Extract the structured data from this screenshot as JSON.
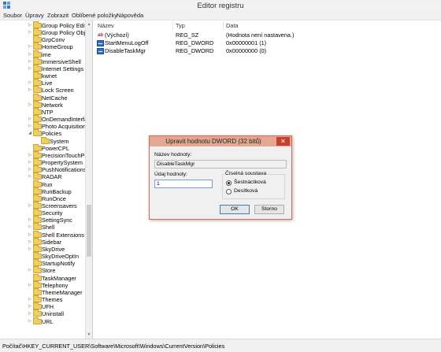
{
  "window": {
    "title": "Editor registru"
  },
  "menu": [
    "Soubor",
    "Úpravy",
    "Zobrazit",
    "Oblíbené položky",
    "Nápověda"
  ],
  "tree": {
    "items": [
      {
        "label": "Group Policy Editor",
        "expander": "▷"
      },
      {
        "label": "Group Policy Objec",
        "expander": "▷"
      },
      {
        "label": "GrpConv",
        "expander": ""
      },
      {
        "label": "HomeGroup",
        "expander": "▷"
      },
      {
        "label": "ime",
        "expander": "▷"
      },
      {
        "label": "ImmersiveShell",
        "expander": "▷"
      },
      {
        "label": "Internet Settings",
        "expander": "▷"
      },
      {
        "label": "kwnet",
        "expander": ""
      },
      {
        "label": "Live",
        "expander": "▷"
      },
      {
        "label": "Lock Screen",
        "expander": "▷"
      },
      {
        "label": "NetCache",
        "expander": ""
      },
      {
        "label": "Network",
        "expander": "▷"
      },
      {
        "label": "NTP",
        "expander": ""
      },
      {
        "label": "OnDemandInterfac",
        "expander": "▷"
      },
      {
        "label": "Photo Acquisition",
        "expander": "▷"
      },
      {
        "label": "Policies",
        "expander": "◢"
      },
      {
        "label": "System",
        "expander": "",
        "child": true
      },
      {
        "label": "PowerCPL",
        "expander": ""
      },
      {
        "label": "PrecisionTouchPad",
        "expander": "▷"
      },
      {
        "label": "PropertySystem",
        "expander": "▷"
      },
      {
        "label": "PushNotifications",
        "expander": "▷"
      },
      {
        "label": "RADAR",
        "expander": "▷"
      },
      {
        "label": "Run",
        "expander": ""
      },
      {
        "label": "RunBackup",
        "expander": ""
      },
      {
        "label": "RunOnce",
        "expander": ""
      },
      {
        "label": "Screensavers",
        "expander": "▷"
      },
      {
        "label": "Security",
        "expander": ""
      },
      {
        "label": "SettingSync",
        "expander": "▷"
      },
      {
        "label": "Shell",
        "expander": "▷"
      },
      {
        "label": "Shell Extensions",
        "expander": "▷"
      },
      {
        "label": "Sidebar",
        "expander": "▷"
      },
      {
        "label": "SkyDrive",
        "expander": "▷"
      },
      {
        "label": "SkyDriveOptIn",
        "expander": ""
      },
      {
        "label": "StartupNotify",
        "expander": ""
      },
      {
        "label": "Store",
        "expander": "▷"
      },
      {
        "label": "TaskManager",
        "expander": ""
      },
      {
        "label": "Telephony",
        "expander": "▷"
      },
      {
        "label": "ThemeManager",
        "expander": ""
      },
      {
        "label": "Themes",
        "expander": "▷"
      },
      {
        "label": "UFH",
        "expander": "▷"
      },
      {
        "label": "Uninstall",
        "expander": "▷"
      },
      {
        "label": "URL",
        "expander": "▷"
      }
    ]
  },
  "list": {
    "columns": [
      "Název",
      "Typ",
      "Data"
    ],
    "rows": [
      {
        "icon": "string-value-icon",
        "badge": "ab",
        "name": "(Výchozí)",
        "type": "REG_SZ",
        "data": "(Hodnota není nastavena.)"
      },
      {
        "icon": "dword-value-icon",
        "badge": "",
        "name": "StartMenuLogOff",
        "type": "REG_DWORD",
        "data": "0x00000001 (1)"
      },
      {
        "icon": "dword-value-icon",
        "badge": "",
        "name": "DisableTaskMgr",
        "type": "REG_DWORD",
        "data": "0x00000000 (0)"
      }
    ]
  },
  "dialog": {
    "title": "Upravit hodnotu DWORD (32 bitů)",
    "close": "✕",
    "name_label": "Název hodnoty:",
    "name_value": "DisableTaskMgr",
    "value_label": "Údaj hodnoty:",
    "value_value": "1",
    "base_label": "Číselná soustava",
    "base_hex": "Šestnáctková",
    "base_dec": "Desítková",
    "selected_base": "Šestnáctková",
    "ok": "OK",
    "cancel": "Storno"
  },
  "status": {
    "path": "Počítač\\HKEY_CURRENT_USER\\Software\\Microsoft\\Windows\\CurrentVersion\\Policies"
  }
}
